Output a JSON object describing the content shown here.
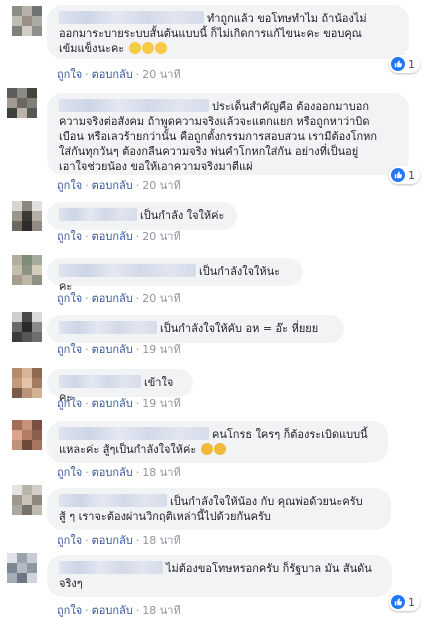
{
  "actions": {
    "like": "ถูกใจ",
    "reply": "ตอบกลับ",
    "sep": "·"
  },
  "comments": [
    {
      "line1": "ทำถูกแล้ว ขอโทษทำไม ถ้าน้องไม่",
      "line2": "ออกมาระบายระบบสั้นต้นแบบนี้ ก็ไม่เกิดการแก้ไขนะคะ ขอบคุณ",
      "line3": "เข้มแข็งนะคะ",
      "time": "20 นาที",
      "reactions": "1",
      "emoji_icons": [
        "thumbs-up-emoji",
        "victory-hand-emoji",
        "horns-hand-emoji"
      ]
    },
    {
      "line1": "ประเด็นสำคัญคือ ต้องออกมาบอก",
      "line2": "ความจริงต่อสังคม ถ้าพูดความจริงแล้วจะแตกแยก หรือถูกหาว่าบิด",
      "line3": "เบือน หรือเลวร้ายกว่านั้น คือถูกตั้งกรรมการสอบสวน เรามีต้องโกหก",
      "line4": "ใส่กันทุกวันๆ ต้องกลืนความจริง พ่นคำโกหกใส่กัน อย่างที่เป็นอยู่",
      "line5": "เอาใจช่วยน้อง ขอให้เอาความจริงมาตีแผ่",
      "time": "20 นาที",
      "reactions": "1"
    },
    {
      "line1": "เป็นกำลัง ใจให้ค่ะ",
      "time": "20 นาที"
    },
    {
      "line1": "เป็นกำลังใจให้นะคะ",
      "time": "20 นาที"
    },
    {
      "line1": "เป็นกำลังใจให้คับ อห = อ๊ะ หี่ยยย",
      "time": "19 นาที"
    },
    {
      "line1": "เข้าใจคะ",
      "time": "19 นาที"
    },
    {
      "line1": "คนโกรธ ใครๆ ก็ต้องระเบิดแบบนี้",
      "line2": "แหละค่ะ สู้ๆเป็นกำลังใจให้ค่ะ",
      "time": "18 นาที",
      "emoji_icons": [
        "clapping-emoji",
        "clapping-emoji"
      ]
    },
    {
      "line1": "เป็นกำลังใจให้น้อง กับ คุณพ่อด้วยนะครับ",
      "line2": "สู้ ๆ เราจะต้องผ่านวิกฤติเหล่านี้ไปด้วยกันครับ",
      "time": "18 นาที"
    },
    {
      "line1": "ไม่ต้องขอโทษหรอกครับ ก็รัฐบาล มัน สันดัน",
      "line2": "จริงๆ",
      "time": "18 นาที",
      "reactions": "1"
    }
  ],
  "colors": {
    "bubble": "#f2f3f5",
    "link": "#385898",
    "meta": "#90949c",
    "like_blue": "#2078f4"
  }
}
